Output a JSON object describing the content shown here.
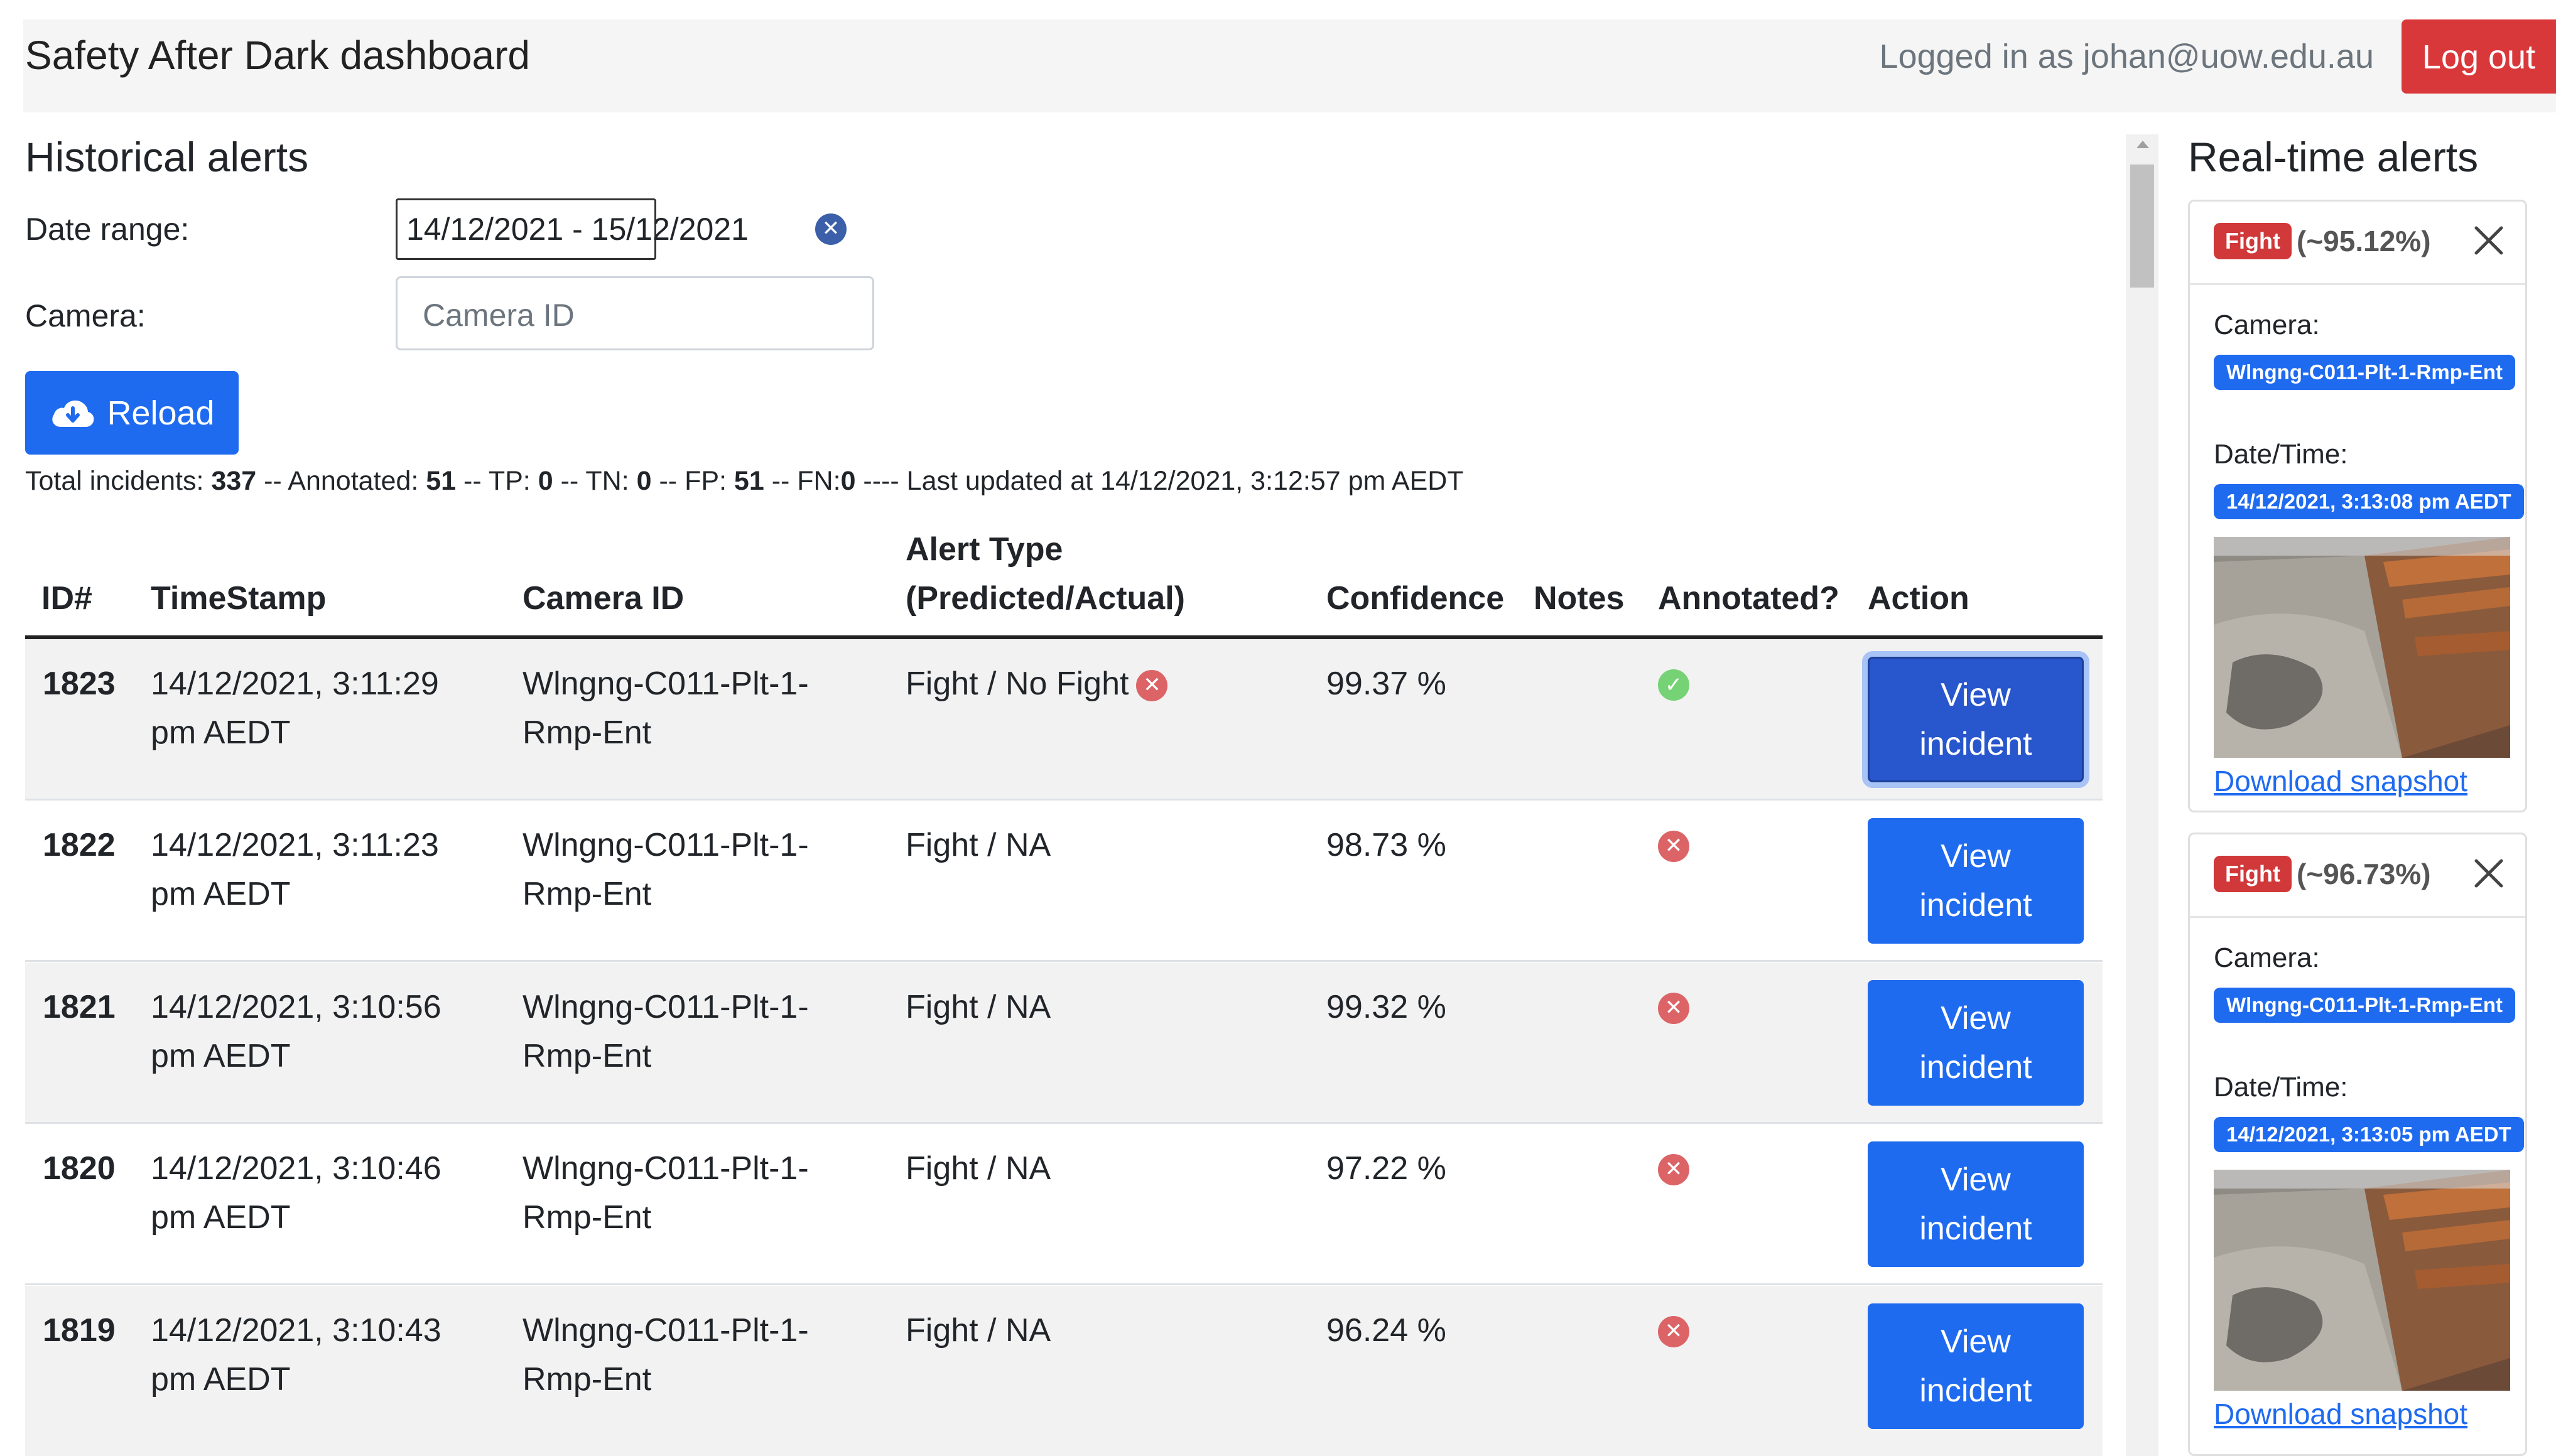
{
  "header": {
    "title": "Safety After Dark dashboard",
    "logged_in": "Logged in as johan@uow.edu.au",
    "logout_label": "Log out"
  },
  "historical": {
    "title": "Historical alerts",
    "date_label": "Date range:",
    "date_value": "14/12/2021 - 15/12/2021",
    "camera_label": "Camera:",
    "camera_placeholder": "Camera ID",
    "reload_label": "Reload",
    "summary": {
      "total_label": "Total incidents: ",
      "total": "337",
      "annotated_label": " -- Annotated: ",
      "annotated": "51",
      "tp_label": " -- TP: ",
      "tp": "0",
      "tn_label": " -- TN: ",
      "tn": "0",
      "fp_label": " -- FP: ",
      "fp": "51",
      "fn_label": " -- FN:",
      "fn": "0",
      "updated": " ---- Last updated at 14/12/2021, 3:12:57 pm AEDT"
    },
    "columns": {
      "id": "ID#",
      "timestamp": "TimeStamp",
      "camera": "Camera ID",
      "alert_type_1": "Alert Type",
      "alert_type_2": "(Predicted/Actual)",
      "confidence": "Confidence",
      "notes": "Notes",
      "annotated": "Annotated?",
      "action": "Action"
    },
    "rows": [
      {
        "id": "1823",
        "ts1": "14/12/2021, 3:11:29",
        "ts2": "pm AEDT",
        "cam1": "Wlngng-C011-Plt-1-",
        "cam2": "Rmp-Ent",
        "type": "Fight / No Fight",
        "type_mismatch": true,
        "confidence": "99.37 %",
        "annotated": true,
        "action1": "View",
        "action2": "incident"
      },
      {
        "id": "1822",
        "ts1": "14/12/2021, 3:11:23",
        "ts2": "pm AEDT",
        "cam1": "Wlngng-C011-Plt-1-",
        "cam2": "Rmp-Ent",
        "type": "Fight / NA",
        "type_mismatch": false,
        "confidence": "98.73 %",
        "annotated": false,
        "action1": "View",
        "action2": "incident"
      },
      {
        "id": "1821",
        "ts1": "14/12/2021, 3:10:56",
        "ts2": "pm AEDT",
        "cam1": "Wlngng-C011-Plt-1-",
        "cam2": "Rmp-Ent",
        "type": "Fight / NA",
        "type_mismatch": false,
        "confidence": "99.32 %",
        "annotated": false,
        "action1": "View",
        "action2": "incident"
      },
      {
        "id": "1820",
        "ts1": "14/12/2021, 3:10:46",
        "ts2": "pm AEDT",
        "cam1": "Wlngng-C011-Plt-1-",
        "cam2": "Rmp-Ent",
        "type": "Fight / NA",
        "type_mismatch": false,
        "confidence": "97.22 %",
        "annotated": false,
        "action1": "View",
        "action2": "incident"
      },
      {
        "id": "1819",
        "ts1": "14/12/2021, 3:10:43",
        "ts2": "pm AEDT",
        "cam1": "Wlngng-C011-Plt-1-",
        "cam2": "Rmp-Ent",
        "type": "Fight / NA",
        "type_mismatch": false,
        "confidence": "96.24 %",
        "annotated": false,
        "action1": "View",
        "action2": "incident"
      }
    ]
  },
  "realtime": {
    "title": "Real-time alerts",
    "alerts": [
      {
        "label": "Fight",
        "confidence": "(~95.12%)",
        "camera_label": "Camera:",
        "camera": "Wlngng-C011-Plt-1-Rmp-Ent",
        "datetime_label": "Date/Time:",
        "datetime": "14/12/2021, 3:13:08 pm AEDT",
        "download": "Download snapshot"
      },
      {
        "label": "Fight",
        "confidence": "(~96.73%)",
        "camera_label": "Camera:",
        "camera": "Wlngng-C011-Plt-1-Rmp-Ent",
        "datetime_label": "Date/Time:",
        "datetime": "14/12/2021, 3:13:05 pm AEDT",
        "download": "Download snapshot"
      }
    ]
  },
  "colors": {
    "primary": "#1f6bf0",
    "danger": "#d9383b",
    "success": "#75d275",
    "error_icon": "#dc6466"
  }
}
